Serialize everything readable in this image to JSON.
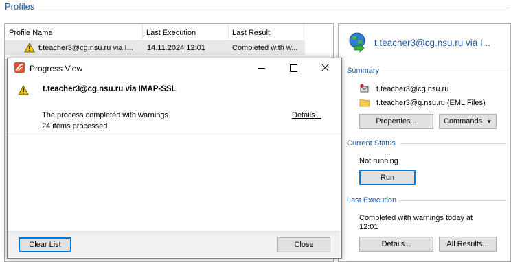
{
  "profiles": {
    "title": "Profiles",
    "columns": [
      "Profile Name",
      "Last Execution",
      "Last Result"
    ],
    "rows": [
      {
        "name": "t.teacher3@cg.nsu.ru via I...",
        "last_execution": "14.11.2024 12:01",
        "last_result": "Completed with w..."
      }
    ]
  },
  "dialog": {
    "title": "Progress View",
    "heading": "t.teacher3@cg.nsu.ru via IMAP-SSL",
    "message": "The process completed with warnings.",
    "count": "24 items processed.",
    "details_link": "Details...",
    "clear_label": "Clear List",
    "close_label": "Close"
  },
  "side": {
    "title": "t.teacher3@cg.nsu.ru via I...",
    "summary": {
      "title": "Summary",
      "source": "t.teacher3@cg.nsu.ru",
      "target": "t.teacher3@g.nsu.ru (EML Files)",
      "properties_label": "Properties...",
      "commands_label": "Commands"
    },
    "status": {
      "title": "Current Status",
      "text": "Not running",
      "run_label": "Run"
    },
    "last_execution": {
      "title": "Last Execution",
      "text_line1": "Completed with warnings today at",
      "text_line2": "12:01",
      "details_label": "Details...",
      "all_results_label": "All Results..."
    }
  },
  "colors": {
    "accent": "#1c5aa8",
    "warning": "#f2c200",
    "focus": "#0078d7"
  },
  "icons": [
    "warning-icon",
    "app-logo-icon",
    "minimize-icon",
    "maximize-icon",
    "close-icon",
    "globe-sync-icon",
    "mail-icon",
    "folder-icon",
    "dropdown-arrow-icon"
  ]
}
